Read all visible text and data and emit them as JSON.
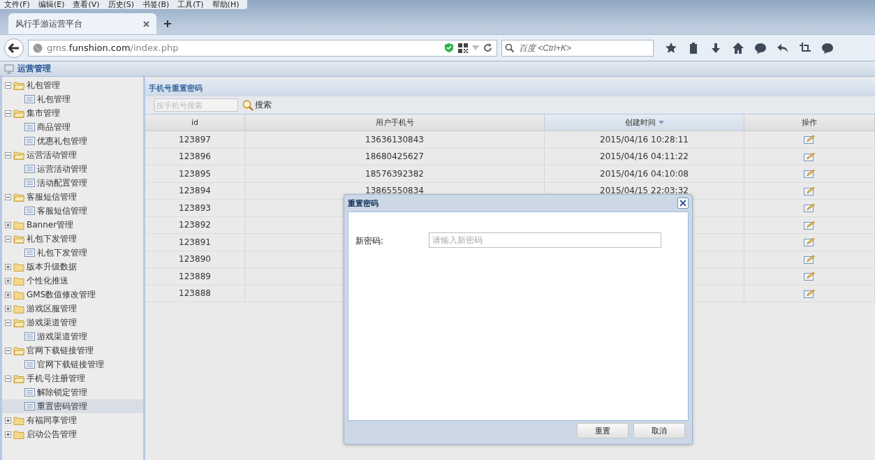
{
  "menu_bar": [
    "文件(F)",
    "编辑(E)",
    "查看(V)",
    "历史(S)",
    "书签(B)",
    "工具(T)",
    "帮助(H)"
  ],
  "tabs": [
    {
      "title": "风行手游运营平台",
      "selected": true
    }
  ],
  "address_bar": {
    "prefix": "gms.",
    "domain": "funshion.com",
    "path": "/index.php"
  },
  "search_box": {
    "placeholder": "百度 <Ctrl+K>"
  },
  "app_header": {
    "title": "运营管理"
  },
  "sidebar": {
    "items": [
      {
        "label": "礼包管理",
        "expanded": true,
        "children": [
          {
            "label": "礼包管理",
            "selected": false
          }
        ]
      },
      {
        "label": "集市管理",
        "expanded": true,
        "children": [
          {
            "label": "商品管理",
            "selected": false
          },
          {
            "label": "优惠礼包管理",
            "selected": false
          }
        ]
      },
      {
        "label": "运营活动管理",
        "expanded": true,
        "children": [
          {
            "label": "运营活动管理",
            "selected": false
          },
          {
            "label": "活动配置管理",
            "selected": false
          }
        ]
      },
      {
        "label": "客服短信管理",
        "expanded": true,
        "children": [
          {
            "label": "客服短信管理",
            "selected": false
          }
        ]
      },
      {
        "label": "Banner管理",
        "expanded": false
      },
      {
        "label": "礼包下发管理",
        "expanded": true,
        "children": [
          {
            "label": "礼包下发管理",
            "selected": false
          }
        ]
      },
      {
        "label": "版本升级数据",
        "expanded": false
      },
      {
        "label": "个性化推送",
        "expanded": false
      },
      {
        "label": "GMS数值修改管理",
        "expanded": false
      },
      {
        "label": "游戏区服管理",
        "expanded": false
      },
      {
        "label": "游戏渠道管理",
        "expanded": true,
        "children": [
          {
            "label": "游戏渠道管理",
            "selected": false
          }
        ]
      },
      {
        "label": "官网下载链接管理",
        "expanded": true,
        "children": [
          {
            "label": "官网下载链接管理",
            "selected": false
          }
        ]
      },
      {
        "label": "手机号注册管理",
        "expanded": true,
        "children": [
          {
            "label": "解除锁定管理",
            "selected": false
          },
          {
            "label": "重置密码管理",
            "selected": true
          }
        ]
      },
      {
        "label": "有福同享管理",
        "expanded": false
      },
      {
        "label": "启动公告管理",
        "expanded": false
      }
    ]
  },
  "panel": {
    "title": "手机号重置密码",
    "search": {
      "placeholder": "按手机号搜索",
      "button": "搜索"
    }
  },
  "table": {
    "columns": [
      {
        "label": "id",
        "sorted": false
      },
      {
        "label": "用户手机号",
        "sorted": false
      },
      {
        "label": "创建时间",
        "sorted": true
      },
      {
        "label": "操作",
        "sorted": false
      }
    ],
    "rows": [
      {
        "id": "123897",
        "phone": "13636130843",
        "created": "2015/04/16 10:28:11"
      },
      {
        "id": "123896",
        "phone": "18680425627",
        "created": "2015/04/16 04:11:22"
      },
      {
        "id": "123895",
        "phone": "18576392382",
        "created": "2015/04/16 04:10:08"
      },
      {
        "id": "123894",
        "phone": "13865550834",
        "created": "2015/04/15 22:03:32"
      },
      {
        "id": "123893"
      },
      {
        "id": "123892"
      },
      {
        "id": "123891"
      },
      {
        "id": "123890"
      },
      {
        "id": "123889"
      },
      {
        "id": "123888"
      }
    ]
  },
  "dialog": {
    "title": "重置密码",
    "field_label": "新密码:",
    "placeholder": "请输入新密码",
    "buttons": [
      "重置",
      "取消"
    ]
  }
}
